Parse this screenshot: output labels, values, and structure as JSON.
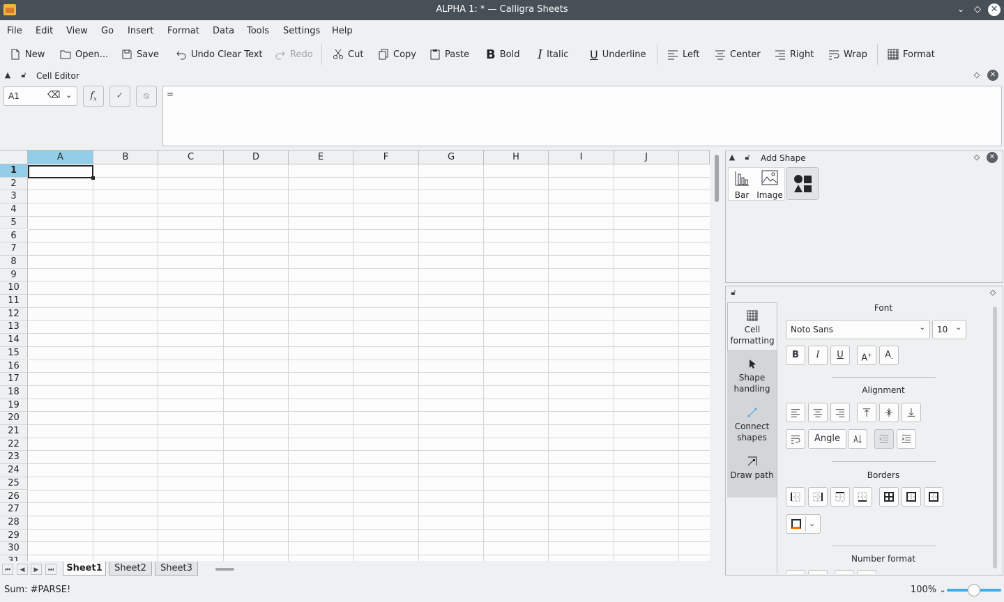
{
  "window": {
    "title": "ALPHA 1: * — Calligra Sheets"
  },
  "menu": [
    "File",
    "Edit",
    "View",
    "Go",
    "Insert",
    "Format",
    "Data",
    "Tools",
    "Settings",
    "Help"
  ],
  "toolbar": {
    "new": "New",
    "open": "Open...",
    "save": "Save",
    "undo": "Undo Clear Text",
    "redo": "Redo",
    "cut": "Cut",
    "copy": "Copy",
    "paste": "Paste",
    "bold": "Bold",
    "italic": "Italic",
    "underline": "Underline",
    "left": "Left",
    "center": "Center",
    "right": "Right",
    "wrap": "Wrap",
    "format": "Format"
  },
  "cell_editor": {
    "title": "Cell Editor",
    "cell_ref": "A1",
    "content": "="
  },
  "grid": {
    "columns": [
      "A",
      "B",
      "C",
      "D",
      "E",
      "F",
      "G",
      "H",
      "I",
      "J"
    ],
    "rows": [
      "1",
      "2",
      "3",
      "4",
      "5",
      "6",
      "7",
      "8",
      "9",
      "10",
      "11",
      "12",
      "13",
      "14",
      "15",
      "16",
      "17",
      "18",
      "19",
      "20",
      "21",
      "22",
      "23",
      "24",
      "25",
      "26",
      "27",
      "28",
      "29",
      "30",
      "31"
    ],
    "selected_col": "A",
    "selected_row": "1"
  },
  "sheets": {
    "tabs": [
      "Sheet1",
      "Sheet2",
      "Sheet3"
    ],
    "active": "Sheet1"
  },
  "status": {
    "text": "Sum: #PARSE!",
    "zoom": "100%"
  },
  "add_shape": {
    "title": "Add Shape",
    "bar": "Bar",
    "image": "Image"
  },
  "tools": {
    "cell_formatting_1": "Cell",
    "cell_formatting_2": "formatting",
    "shape_handling_1": "Shape",
    "shape_handling_2": "handling",
    "connect_shapes_1": "Connect",
    "connect_shapes_2": "shapes",
    "draw_path": "Draw path"
  },
  "format_panel": {
    "font_title": "Font",
    "font_name": "Noto Sans",
    "font_size": "10",
    "alignment_title": "Alignment",
    "angle": "Angle",
    "borders_title": "Borders",
    "number_format_title": "Number format"
  },
  "colors": {
    "accent": "#93cee9",
    "titlebar": "#475057"
  }
}
